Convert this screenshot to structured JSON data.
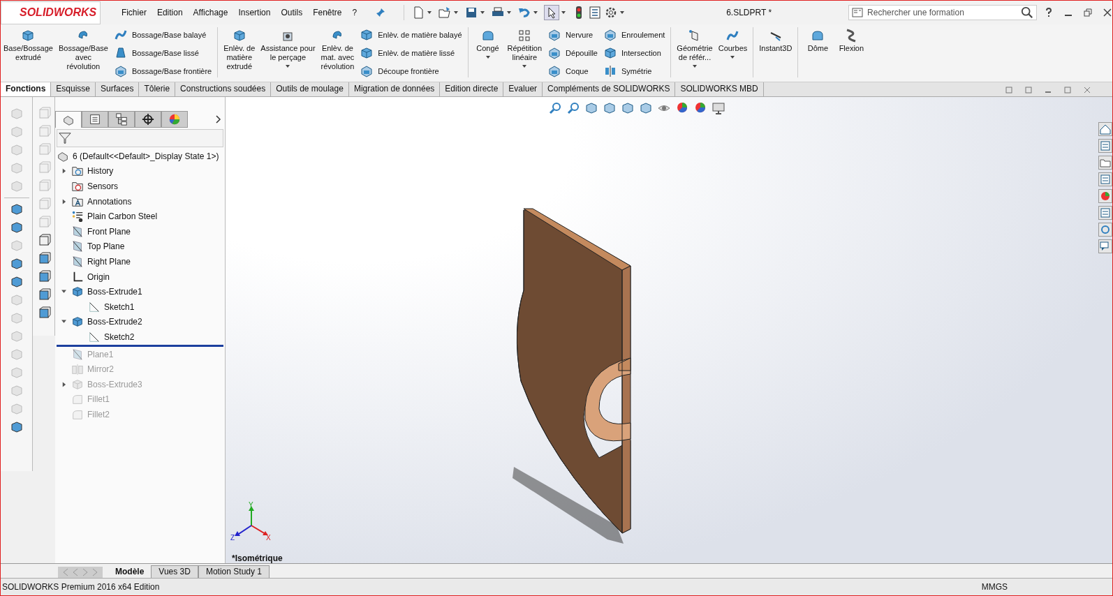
{
  "app": {
    "logo": "SOLIDWORKS",
    "document_title": "6.SLDPRT *"
  },
  "menu": [
    "Fichier",
    "Edition",
    "Affichage",
    "Insertion",
    "Outils",
    "Fenêtre",
    "?"
  ],
  "search": {
    "placeholder": "Rechercher une formation"
  },
  "ribbon": [
    {
      "kind": "big",
      "label": "Base/Bossage\nextrudé",
      "dropdown": false
    },
    {
      "kind": "big",
      "label": "Bossage/Base\navec\nrévolution",
      "dropdown": false
    },
    {
      "kind": "stack",
      "items": [
        {
          "label": "Bossage/Base balayé"
        },
        {
          "label": "Bossage/Base lissé"
        },
        {
          "label": "Bossage/Base frontière"
        }
      ]
    },
    {
      "kind": "sep"
    },
    {
      "kind": "big",
      "label": "Enlèv. de\nmatière\nextrudé",
      "dropdown": false
    },
    {
      "kind": "big",
      "label": "Assistance pour\nle perçage",
      "dropdown": true
    },
    {
      "kind": "big",
      "label": "Enlèv. de\nmat. avec\nrévolution",
      "dropdown": false
    },
    {
      "kind": "stack",
      "items": [
        {
          "label": "Enlèv. de matière balayé"
        },
        {
          "label": "Enlèv. de matière lissé"
        },
        {
          "label": "Découpe frontière"
        }
      ]
    },
    {
      "kind": "sep"
    },
    {
      "kind": "big",
      "label": "Congé",
      "dropdown": true
    },
    {
      "kind": "big",
      "label": "Répétition\nlinéaire",
      "dropdown": true
    },
    {
      "kind": "stack",
      "items": [
        {
          "label": "Nervure"
        },
        {
          "label": "Dépouille"
        },
        {
          "label": "Coque"
        }
      ]
    },
    {
      "kind": "stack",
      "items": [
        {
          "label": "Enroulement"
        },
        {
          "label": "Intersection"
        },
        {
          "label": "Symétrie"
        }
      ]
    },
    {
      "kind": "sep"
    },
    {
      "kind": "big",
      "label": "Géométrie\nde référ...",
      "dropdown": true
    },
    {
      "kind": "big",
      "label": "Courbes",
      "dropdown": true
    },
    {
      "kind": "sep"
    },
    {
      "kind": "big",
      "label": "Instant3D",
      "dropdown": false
    },
    {
      "kind": "sep"
    },
    {
      "kind": "big",
      "label": "Dôme",
      "dropdown": false
    },
    {
      "kind": "big",
      "label": "Flexion",
      "dropdown": false
    }
  ],
  "panel_tabs": [
    {
      "selected": true
    },
    {
      "selected": false
    },
    {
      "selected": false
    },
    {
      "selected": false
    },
    {
      "selected": false
    }
  ],
  "command_tabs": [
    {
      "label": "Fonctions",
      "selected": true
    },
    {
      "label": "Esquisse",
      "selected": false
    },
    {
      "label": "Surfaces",
      "selected": false
    },
    {
      "label": "Tôlerie",
      "selected": false
    },
    {
      "label": "Constructions soudées",
      "selected": false
    },
    {
      "label": "Outils de moulage",
      "selected": false
    },
    {
      "label": "Migration de données",
      "selected": false
    },
    {
      "label": "Edition directe",
      "selected": false
    },
    {
      "label": "Evaluer",
      "selected": false
    },
    {
      "label": "Compléments de SOLIDWORKS",
      "selected": false
    },
    {
      "label": "SOLIDWORKS MBD",
      "selected": false
    }
  ],
  "tree": {
    "root": "6  (Default<<Default>_Display State 1>)",
    "items": [
      {
        "label": "History",
        "kind": "history",
        "rolled_back": false,
        "expanded": false,
        "has_children": true
      },
      {
        "label": "Sensors",
        "kind": "sensors",
        "rolled_back": false,
        "has_children": false
      },
      {
        "label": "Annotations",
        "kind": "annotations",
        "rolled_back": false,
        "expanded": false,
        "has_children": true
      },
      {
        "label": "Plain Carbon Steel",
        "kind": "material",
        "rolled_back": false,
        "has_children": false
      },
      {
        "label": "Front Plane",
        "kind": "plane",
        "rolled_back": false,
        "has_children": false
      },
      {
        "label": "Top Plane",
        "kind": "plane",
        "rolled_back": false,
        "has_children": false
      },
      {
        "label": "Right Plane",
        "kind": "plane",
        "rolled_back": false,
        "has_children": false
      },
      {
        "label": "Origin",
        "kind": "origin",
        "rolled_back": false,
        "has_children": false
      },
      {
        "label": "Boss-Extrude1",
        "kind": "extrude",
        "rolled_back": false,
        "expanded": true,
        "has_children": true,
        "children": [
          {
            "label": "Sketch1",
            "kind": "sketch",
            "rolled_back": false,
            "has_children": false
          }
        ]
      },
      {
        "label": "Boss-Extrude2",
        "kind": "extrude",
        "rolled_back": false,
        "expanded": true,
        "has_children": true,
        "children": [
          {
            "label": "Sketch2",
            "kind": "sketch",
            "rolled_back": false,
            "has_children": false
          }
        ]
      },
      {
        "label": "Plane1",
        "kind": "plane",
        "rolled_back": true,
        "has_children": false
      },
      {
        "label": "Mirror2",
        "kind": "mirror",
        "rolled_back": true,
        "has_children": false
      },
      {
        "label": "Boss-Extrude3",
        "kind": "extrude",
        "rolled_back": true,
        "expanded": false,
        "has_children": true
      },
      {
        "label": "Fillet1",
        "kind": "fillet",
        "rolled_back": true,
        "has_children": false
      },
      {
        "label": "Fillet2",
        "kind": "fillet",
        "rolled_back": true,
        "has_children": false
      }
    ]
  },
  "viewport": {
    "view_name": "*Isométrique",
    "triad": [
      "Y",
      "Z",
      "X"
    ]
  },
  "bottom_tabs": [
    {
      "label": "Modèle",
      "selected": true
    },
    {
      "label": "Vues 3D",
      "selected": false
    },
    {
      "label": "Motion Study 1",
      "selected": false
    }
  ],
  "status_bar": {
    "text": "SOLIDWORKS Premium 2016 x64 Edition",
    "units": "MMGS"
  }
}
